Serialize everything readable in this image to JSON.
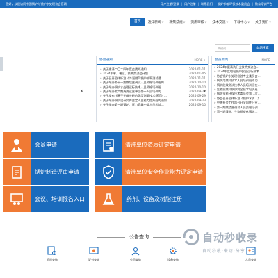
{
  "topbar": {
    "welcome": "您好，欢迎访问中国锅炉与锅炉水处理协会官网",
    "links": [
      "用户注册/登录",
      "用户注册",
      "联系我们",
      "锅炉节能环保技术委员会",
      "教育培训平台"
    ]
  },
  "nav": {
    "items": [
      "首页",
      "通知新闻",
      "政策法规",
      "资质审核",
      "技术交流",
      "下载中心",
      "关于我们"
    ],
    "with_caret": [
      false,
      true,
      true,
      true,
      true,
      true,
      true
    ]
  },
  "search": {
    "placeholder": "关键词",
    "button": "站内搜索"
  },
  "notices": {
    "title": "协会通知",
    "more": "MORE +",
    "items": [
      {
        "title": "» 关于邀请二〇二四年度会费的通知",
        "date": "2024-01-11"
      },
      {
        "title": "» 2024年寒、暑运、技术交流会计划",
        "date": "2024-01-05"
      },
      {
        "title": "» 关于召开团体标准《冷凝燃气锅炉效率测试通…",
        "date": "2024-11-11"
      },
      {
        "title": "» 关于举办第十一期燃烧器调试人员资格培训班的…",
        "date": "2024-10-10"
      },
      {
        "title": "» 关于举办锅炉水处理运行技术人员资格培训班…",
        "date": "2024-10-10"
      },
      {
        "title": "» 关于举办第六期清洗运营单位骨干人员培训的…",
        "date": "2024-09-27"
      },
      {
        "title": "» 关于发布《基于光谱分析的温度测量技术规范》…",
        "date": "2024-09-29"
      },
      {
        "title": "» 关于举办锅炉设计文件鉴定人员能力提升班的通知",
        "date": "2024-09-23"
      },
      {
        "title": "» 关于举办第三期锅炉、压力容器中级人员考试…",
        "date": "2024-09-10"
      }
    ]
  },
  "member_news": {
    "title": "会员新闻",
    "more": "MORE +",
    "items": [
      "» 2024年度清洗行业技术交流会…",
      "» 2024年度电站锅炉安全运行技术…",
      "» 协会锅炉水处理检验专业委员会…",
      "» 锅炉用燃料技术人员培训班成功…",
      "» 锅炉能效测试技术人员培训班在…",
      "» 生物质燃料锅炉安全技术培训班…",
      "» 锅炉节能环保技术委员会第…次…",
      "» 协会召开团体标准《锅炉水质…》",
      "» 中央社会工作部召开全国性行业…",
      "» 第一期燃烧器调试人员资格培训…",
      "» 第一期清洗、生物质炭化锅炉…"
    ]
  },
  "tiles": [
    {
      "label": "会员申请",
      "color": "blue",
      "icon": "member-badge-icon"
    },
    {
      "label": "清洗单位资质评定申请",
      "color": "orange",
      "icon": "cleaning-certificate-icon"
    },
    {
      "label": "锅炉制造评审申请",
      "color": "orange",
      "icon": "boiler-document-icon"
    },
    {
      "label": "清洗单位安全作业能力评定申请",
      "color": "orange",
      "icon": "safety-shield-icon"
    },
    {
      "label": "会议、培训报名入口",
      "color": "blue",
      "icon": "meeting-presentation-icon"
    },
    {
      "label": "药剂、设备及树脂注册",
      "color": "blue",
      "icon": "chemical-flask-icon"
    }
  ],
  "notice_section": {
    "title": "公告查询",
    "items": [
      "资质查询",
      "证书查询",
      "会员查询",
      "设备查询",
      "人员查询"
    ]
  },
  "watermark": {
    "text": "自动秒收录",
    "sub": "自助秒收·来访·分享"
  },
  "colors": {
    "primary": "#1a6bbd",
    "orange": "#f07a34"
  }
}
